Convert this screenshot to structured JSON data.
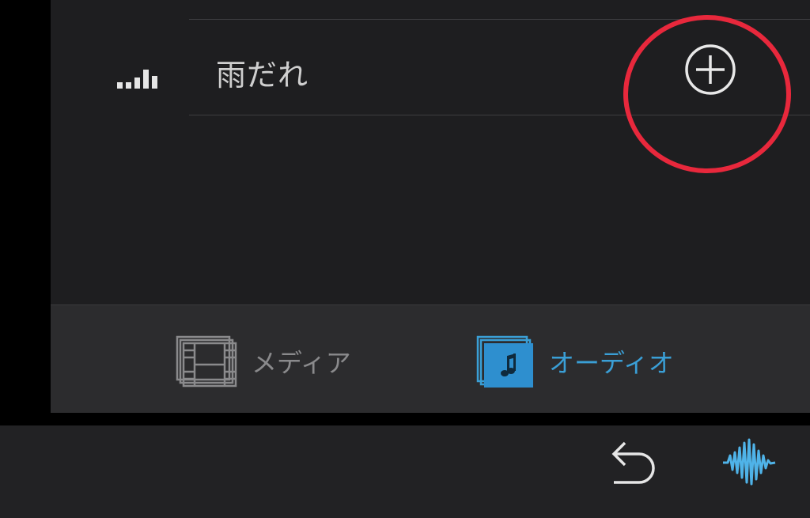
{
  "track": {
    "title": "雨だれ",
    "signal_icon": "signal-bars-icon",
    "add_icon": "add-circle-icon"
  },
  "annotation": {
    "shape": "circle",
    "color": "#e8283c"
  },
  "tabs": [
    {
      "label": "メディア",
      "icon": "film-stack-icon",
      "active": false,
      "color": "#8a8a8c"
    },
    {
      "label": "オーディオ",
      "icon": "music-note-icon",
      "active": true,
      "color": "#3a9fd6"
    }
  ],
  "toolbar": {
    "undo_icon": "undo-icon",
    "waveform_icon": "waveform-icon",
    "accent": "#4fb3e8"
  },
  "colors": {
    "panel_bg": "#1e1e20",
    "tabbar_bg": "#2c2c2e",
    "bottombar_bg": "#222224",
    "text_primary": "#cfcfcf"
  }
}
